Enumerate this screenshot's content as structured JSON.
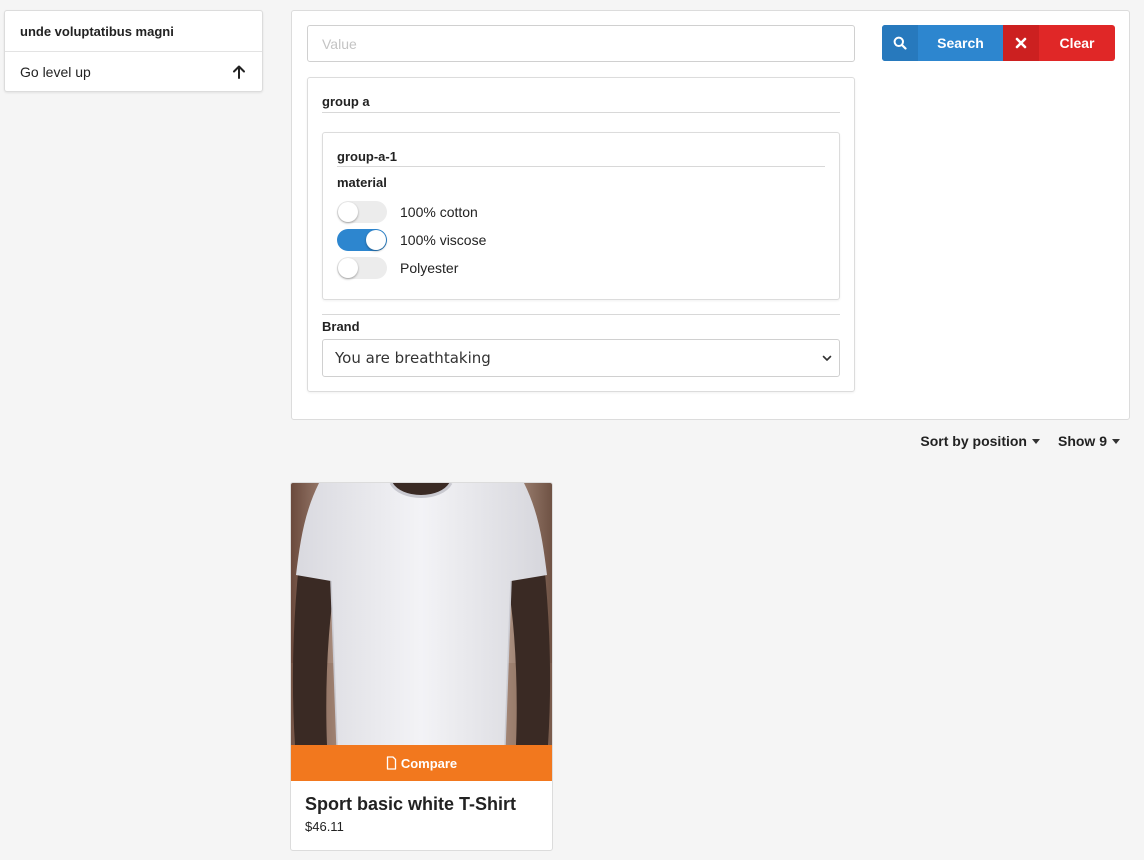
{
  "sidebar": {
    "category_title": "unde voluptatibus magni",
    "level_up_label": "Go level up",
    "level_up_icon": "arrow-up-icon"
  },
  "filters": {
    "value_input": {
      "placeholder": "Value",
      "value": ""
    },
    "search_label": "Search",
    "search_icon": "search-icon",
    "clear_label": "Clear",
    "clear_icon": "close-icon",
    "group_title": "group a",
    "subgroup_title": "group-a-1",
    "attribute_name": "material",
    "options": [
      {
        "label": "100% cotton",
        "checked": false
      },
      {
        "label": "100% viscose",
        "checked": true
      },
      {
        "label": "Polyester",
        "checked": false
      }
    ],
    "brand_label": "Brand",
    "brand_selected": "You are breathtaking"
  },
  "toolbar": {
    "sort_label": "Sort by position",
    "show_label": "Show 9"
  },
  "product": {
    "name": "Sport basic white T-Shirt",
    "price": "$46.11",
    "compare_label": "Compare",
    "compare_icon": "document-icon"
  },
  "colors": {
    "primary": "#2d86cf",
    "danger": "#e02727",
    "accent": "#f2781e"
  }
}
